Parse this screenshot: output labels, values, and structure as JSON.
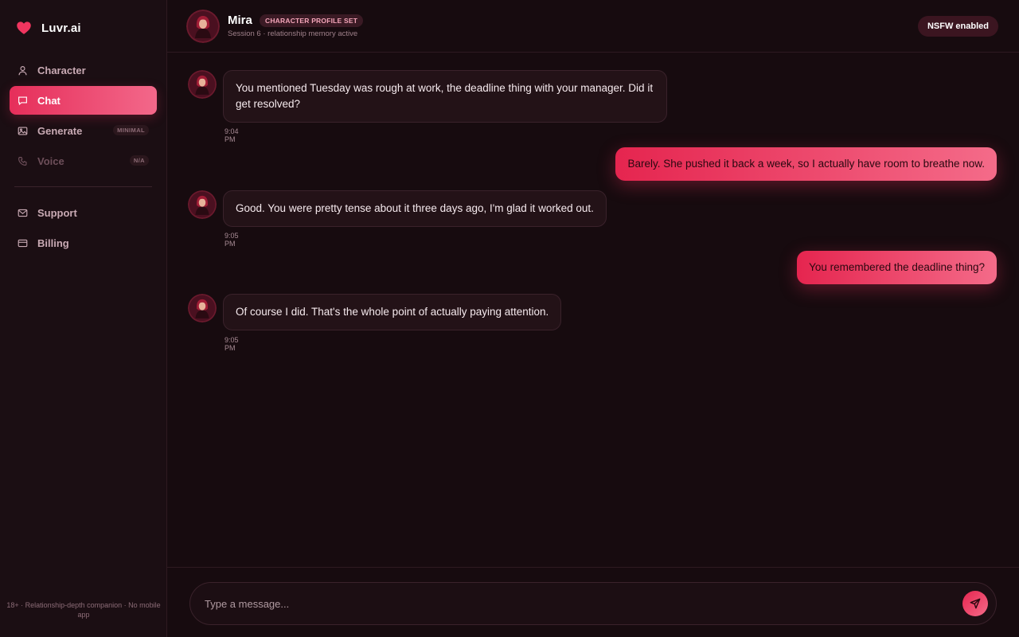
{
  "brand": {
    "name": "Luvr.ai",
    "icon": "heart-icon",
    "accent": "#e62e5a"
  },
  "sidebar": {
    "items": [
      {
        "label": "Character",
        "icon": "user-icon"
      },
      {
        "label": "Chat",
        "icon": "chat-bubble-icon",
        "active": true
      },
      {
        "label": "Generate",
        "icon": "image-icon",
        "badge": "MINIMAL"
      },
      {
        "label": "Voice",
        "icon": "phone-icon",
        "badge": "N/A",
        "disabled": true
      },
      {
        "label": "Support",
        "icon": "mail-icon"
      },
      {
        "label": "Billing",
        "icon": "card-icon"
      }
    ],
    "footer": "18+ · Relationship-depth companion · No mobile app"
  },
  "header": {
    "name": "Mira",
    "badge": "CHARACTER PROFILE SET",
    "subtitle": "Session 6 · relationship memory active",
    "nsfw": "NSFW enabled"
  },
  "messages": [
    {
      "from": "bot",
      "text": "You mentioned Tuesday was rough at work, the deadline thing with your manager. Did it get resolved?",
      "time": "9:04 PM"
    },
    {
      "from": "user",
      "text": "Barely. She pushed it back a week, so I actually have room to breathe now."
    },
    {
      "from": "bot",
      "text": "Good. You were pretty tense about it three days ago, I'm glad it worked out.",
      "time": "9:05 PM"
    },
    {
      "from": "user",
      "text": "You remembered the deadline thing?"
    },
    {
      "from": "bot",
      "text": "Of course I did. That's the whole point of actually paying attention.",
      "time": "9:05 PM"
    }
  ],
  "composer": {
    "placeholder": "Type a message...",
    "send_icon": "send-icon"
  }
}
